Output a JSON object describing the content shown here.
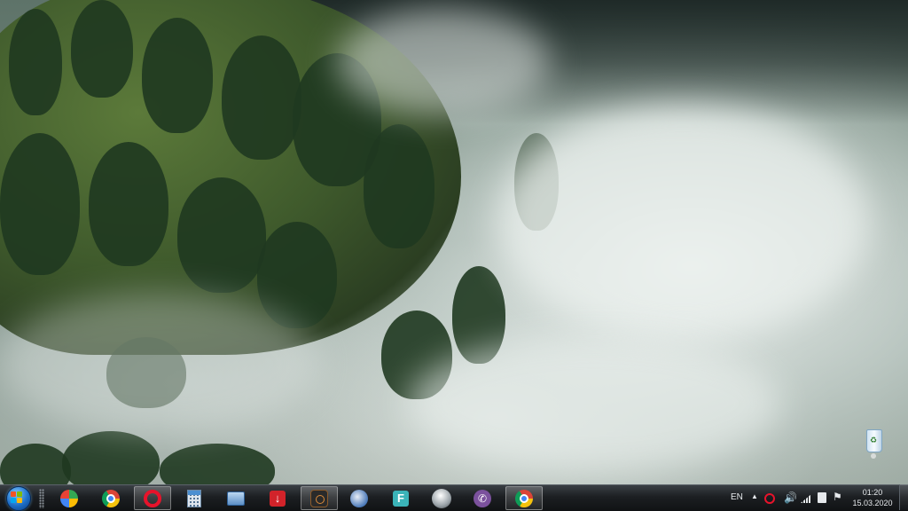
{
  "taskbar": {
    "start_label": "Start",
    "pinned": [
      {
        "name": "google-maps"
      },
      {
        "name": "chrome"
      },
      {
        "name": "opera"
      },
      {
        "name": "calculator"
      },
      {
        "name": "network"
      },
      {
        "name": "download-manager"
      },
      {
        "name": "video-capture"
      },
      {
        "name": "security"
      },
      {
        "name": "f-app"
      },
      {
        "name": "pro-app"
      },
      {
        "name": "viber"
      },
      {
        "name": "chrome-window"
      }
    ]
  },
  "tray": {
    "language": "EN",
    "time": "01:20",
    "date": "15.03.2020"
  },
  "colors": {
    "taskbar_top": "#3a3f44",
    "taskbar_bottom": "#101214",
    "accent": "#1d6fc8"
  }
}
